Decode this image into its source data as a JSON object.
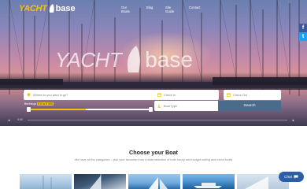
{
  "brand": {
    "logo_part1": "YACHT",
    "logo_part2": "base"
  },
  "nav": {
    "items": [
      "Our Boats",
      "Blog",
      "Site Guide",
      "Contact"
    ]
  },
  "social": {
    "facebook": "f",
    "twitter": "t"
  },
  "hero": {
    "big_logo_part1": "YACHT",
    "big_logo_part2": "base"
  },
  "search": {
    "where_placeholder": "Where do you want to go?",
    "checkin_placeholder": "Check In",
    "checkout_placeholder": "Check Out",
    "boat_type_placeholder": "Boat Type",
    "button_label": "Search",
    "berths_label": "Berthings",
    "berths_value": "€ 0 to € 500"
  },
  "video": {
    "play": "►",
    "time": "0:00",
    "volume": "◄"
  },
  "section": {
    "title": "Choose your Boat",
    "subtitle": "We have all the categories – pick your favourite from a wide selection of both luxury and budget sailing and motor boats"
  },
  "chat": {
    "label": "Chat"
  },
  "colors": {
    "accent": "#f5c300",
    "search_button": "#4a6b8c",
    "chat": "#2c5ea8"
  }
}
